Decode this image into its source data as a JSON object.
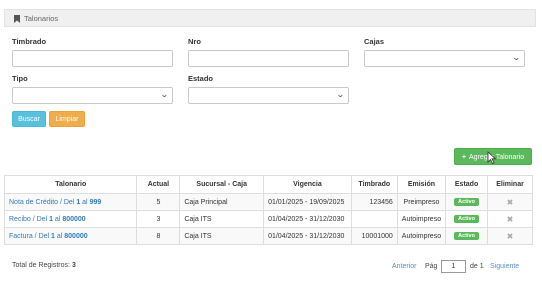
{
  "panel": {
    "title": "Talonarios",
    "icon": "bookmark-icon"
  },
  "filters": {
    "timbrado_label": "Timbrado",
    "nro_label": "Nro",
    "cajas_label": "Cajas",
    "tipo_label": "Tipo",
    "estado_label": "Estado",
    "timbrado_value": "",
    "nro_value": "",
    "cajas_selected": "",
    "tipo_selected": "",
    "estado_selected": ""
  },
  "buttons": {
    "buscar": "Buscar",
    "limpiar": "Limpiar",
    "agregar": "Agregar Talonario"
  },
  "table": {
    "headers": [
      "Talonario",
      "Actual",
      "Sucursal - Caja",
      "Vigencia",
      "Timbrado",
      "Emisión",
      "Estado",
      "Eliminar"
    ],
    "rows": [
      {
        "tal_prefix": "Nota de Crédito / Del ",
        "tal_from": "1",
        "tal_mid": " al ",
        "tal_to": "999",
        "actual": "5",
        "sucursal": "Caja Principal",
        "vigencia": "01/01/2025 - 19/09/2025",
        "timbrado": "123456",
        "emision": "Preimpreso",
        "estado": "Activo"
      },
      {
        "tal_prefix": "Recibo / Del ",
        "tal_from": "1",
        "tal_mid": " al ",
        "tal_to": "800000",
        "actual": "3",
        "sucursal": "Caja ITS",
        "vigencia": "01/04/2025 - 31/12/2030",
        "timbrado": "",
        "emision": "Autoimpreso",
        "estado": "Activo"
      },
      {
        "tal_prefix": "Factura / Del ",
        "tal_from": "1",
        "tal_mid": " al ",
        "tal_to": "800000",
        "actual": "8",
        "sucursal": "Caja ITS",
        "vigencia": "01/04/2025 - 31/12/2030",
        "timbrado": "10001000",
        "emision": "Autoimpreso",
        "estado": "Activo"
      }
    ]
  },
  "footer": {
    "total_label": "Total de Registros:",
    "total_value": "3",
    "anterior": "Anterior",
    "pag_label": "Pág",
    "page_value": "1",
    "de_label": "de 1",
    "siguiente": "Siguiente"
  },
  "colors": {
    "success": "#5cb85c",
    "info": "#5bc0de",
    "warning": "#f0ad4e",
    "link": "#337ab7"
  }
}
